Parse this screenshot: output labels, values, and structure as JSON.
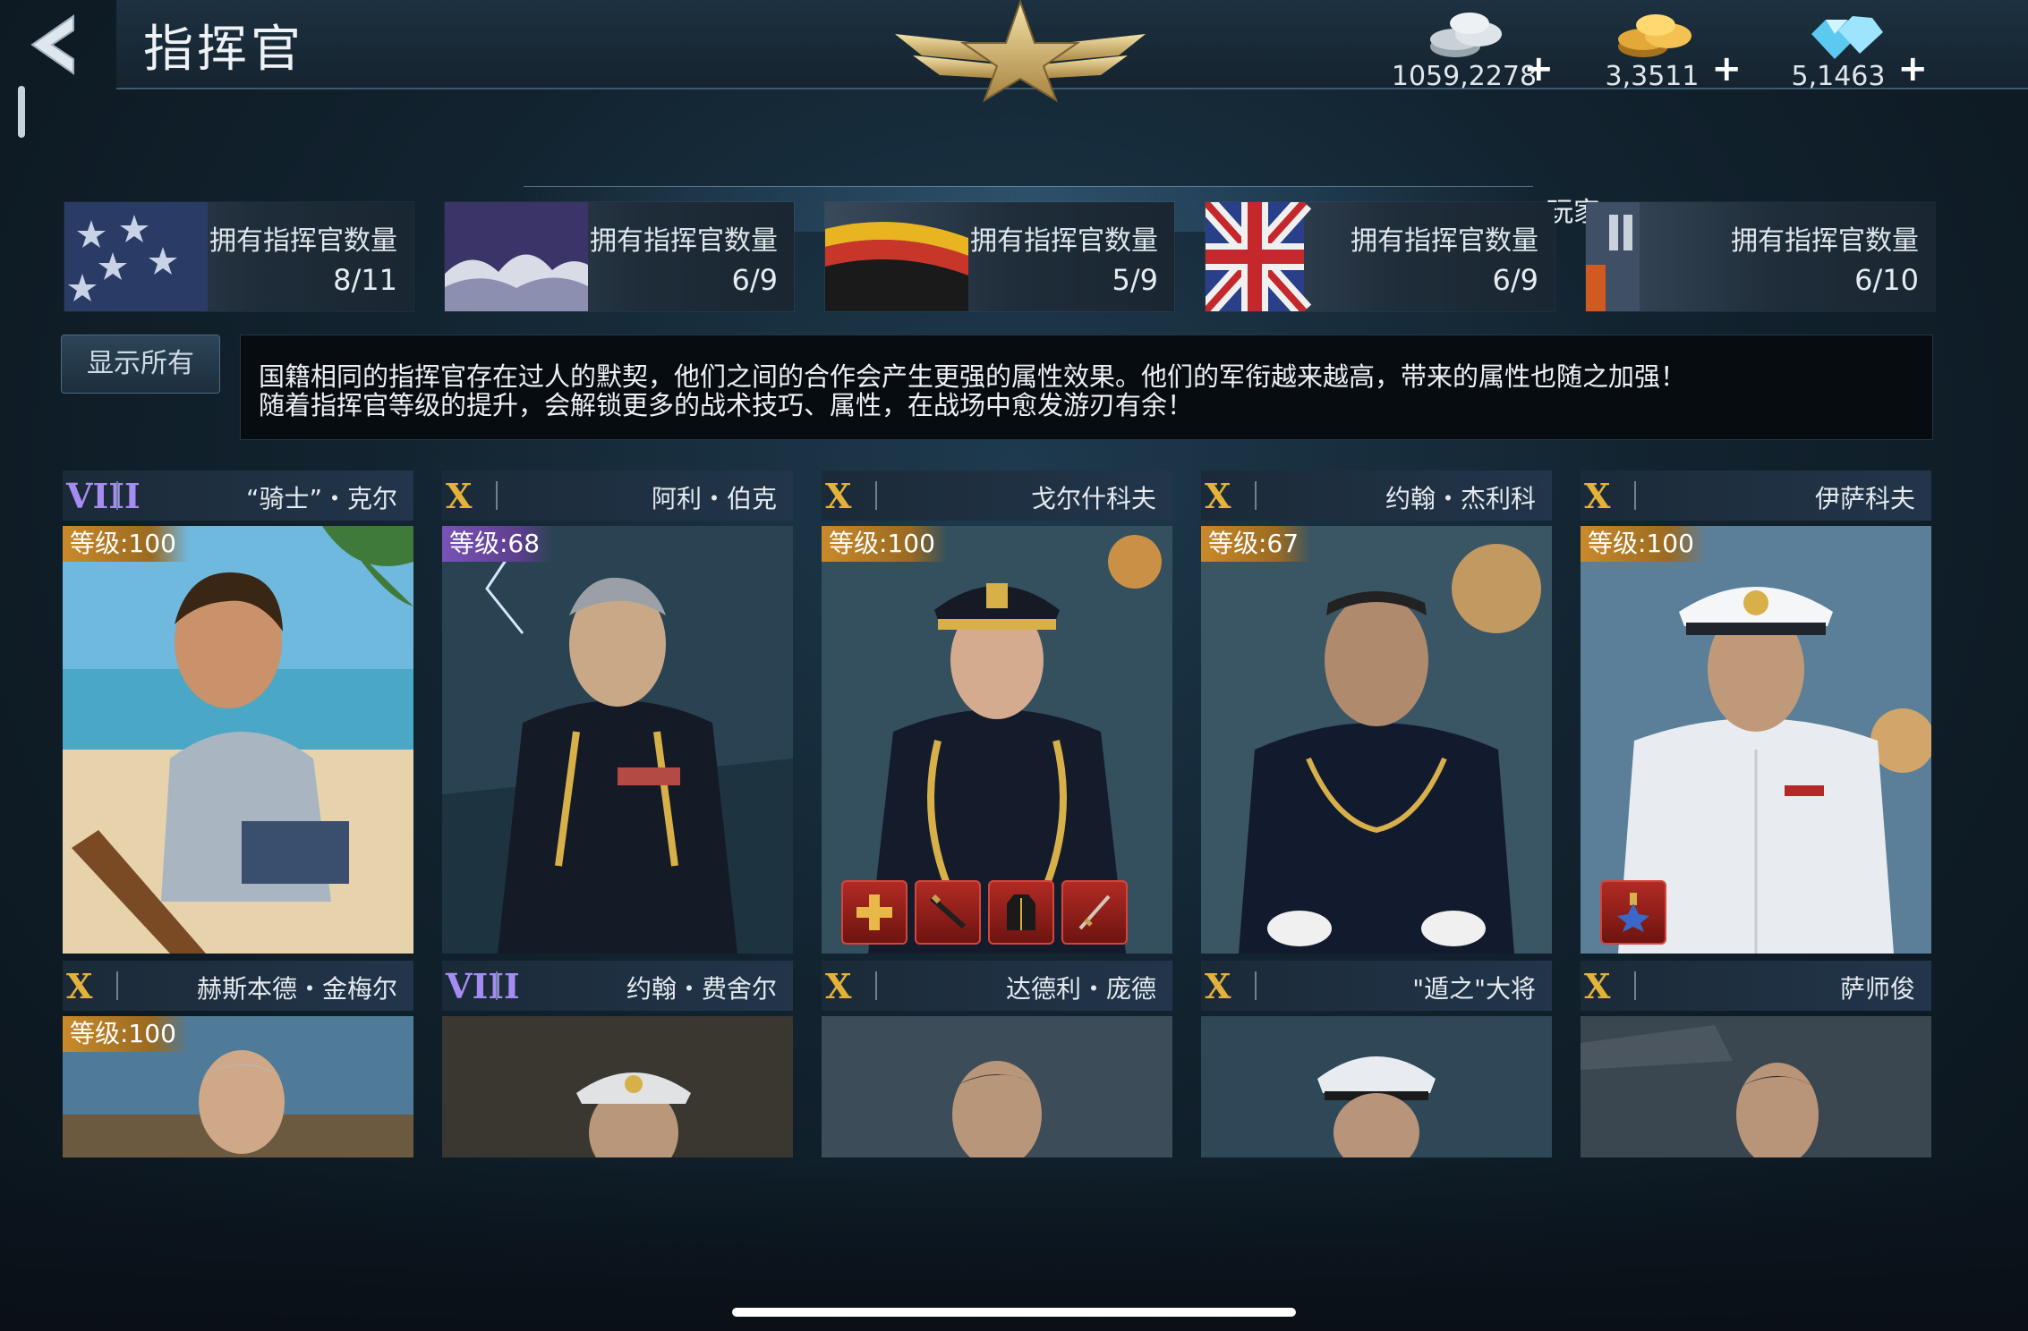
{
  "header": {
    "title": "指挥官",
    "back_icon": "back-arrow-icon",
    "emblem_icon": "star-wings-emblem-icon"
  },
  "currencies": [
    {
      "name": "silver",
      "icon": "silver-coins-icon",
      "value": "1059,2278",
      "plus": "+"
    },
    {
      "name": "gold",
      "icon": "gold-coins-icon",
      "value": "3,3511",
      "plus": "+"
    },
    {
      "name": "diamond",
      "icon": "diamonds-icon",
      "value": "5,1463",
      "plus": "+"
    }
  ],
  "player_label": "玩家",
  "nations": [
    {
      "flag_icon": "usa-flag-icon",
      "label": "拥有指挥官数量",
      "count": "8/11"
    },
    {
      "flag_icon": "japan-flag-icon",
      "label": "拥有指挥官数量",
      "count": "6/9"
    },
    {
      "flag_icon": "germany-flag-icon",
      "label": "拥有指挥官数量",
      "count": "5/9"
    },
    {
      "flag_icon": "uk-flag-icon",
      "label": "拥有指挥官数量",
      "count": "6/9"
    },
    {
      "flag_icon": "soviet-flag-icon",
      "label": "拥有指挥官数量",
      "count": "6/10"
    }
  ],
  "filter": {
    "show_all": "显示所有"
  },
  "description": {
    "line1": "国籍相同的指挥官存在过人的默契，他们之间的合作会产生更强的属性效果。他们的军衔越来越高，带来的属性也随之加强！",
    "line2": "随着指挥官等级的提升，会解锁更多的战术技巧、属性，在战场中愈发游刃有余！"
  },
  "commanders_row1": [
    {
      "rank": "VIII",
      "rank_color": "purple",
      "name": "“骑士”・克尔",
      "level": "等级:100",
      "level_color": "orange",
      "medals": []
    },
    {
      "rank": "X",
      "rank_color": "gold",
      "name": "阿利・伯克",
      "level": "等级:68",
      "level_color": "purple",
      "medals": []
    },
    {
      "rank": "X",
      "rank_color": "gold",
      "name": "戈尔什科夫",
      "level": "等级:100",
      "level_color": "orange",
      "medals": [
        "cross-medal-icon",
        "dagger-icon",
        "coat-icon",
        "sword-icon"
      ]
    },
    {
      "rank": "X",
      "rank_color": "gold",
      "name": "约翰・杰利科",
      "level": "等级:67",
      "level_color": "orange",
      "medals": []
    },
    {
      "rank": "X",
      "rank_color": "gold",
      "name": "伊萨科夫",
      "level": "等级:100",
      "level_color": "orange",
      "medals": [
        "order-star-icon"
      ]
    }
  ],
  "commanders_row2": [
    {
      "rank": "X",
      "rank_color": "gold",
      "name": "赫斯本德・金梅尔",
      "level": "等级:100"
    },
    {
      "rank": "VIII",
      "rank_color": "purple",
      "name": "约翰・费舍尔",
      "level": ""
    },
    {
      "rank": "X",
      "rank_color": "gold",
      "name": "达德利・庞德",
      "level": ""
    },
    {
      "rank": "X",
      "rank_color": "gold",
      "name": "\"遁之\"大将",
      "level": ""
    },
    {
      "rank": "X",
      "rank_color": "gold",
      "name": "萨师俊",
      "level": ""
    }
  ]
}
